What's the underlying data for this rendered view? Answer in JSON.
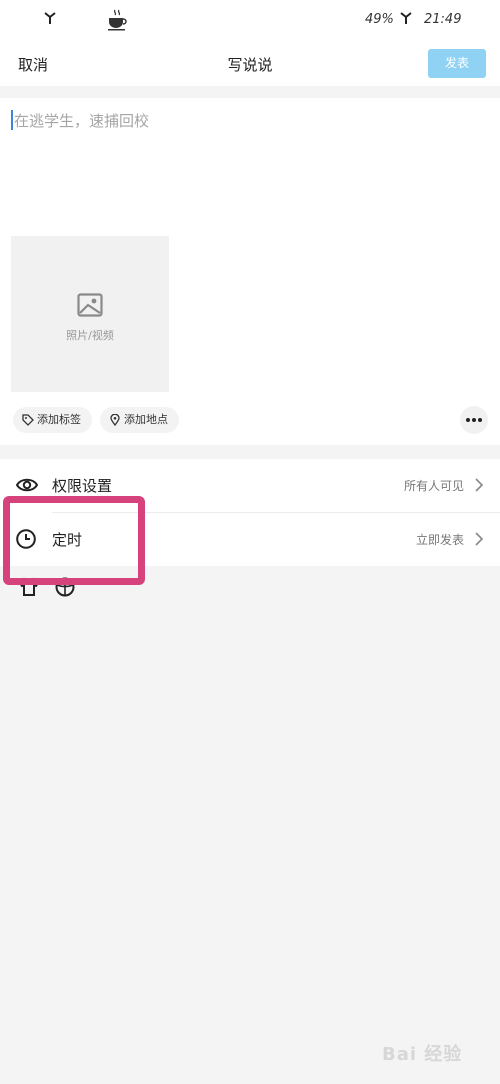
{
  "status_bar": {
    "battery_percent": "49%",
    "time": "21:49",
    "icons": [
      "signal-icon",
      "coffee-icon",
      "signal-icon"
    ]
  },
  "nav": {
    "cancel_label": "取消",
    "title": "写说说",
    "publish_label": "发表"
  },
  "compose": {
    "placeholder": "在逃学生，速捕回校",
    "media_label": "照片/视频",
    "chips": {
      "tag_label": "添加标签",
      "location_label": "添加地点"
    }
  },
  "settings": {
    "rows": [
      {
        "label": "权限设置",
        "value": "所有人可见",
        "icon": "eye-icon"
      },
      {
        "label": "定时",
        "value": "立即发表",
        "icon": "clock-icon"
      }
    ]
  },
  "colors": {
    "publish_button": "#8fd2f4",
    "highlight_border": "#d6437c",
    "caret": "#3a86d8"
  },
  "watermark": {
    "text": "Bai 经验"
  }
}
